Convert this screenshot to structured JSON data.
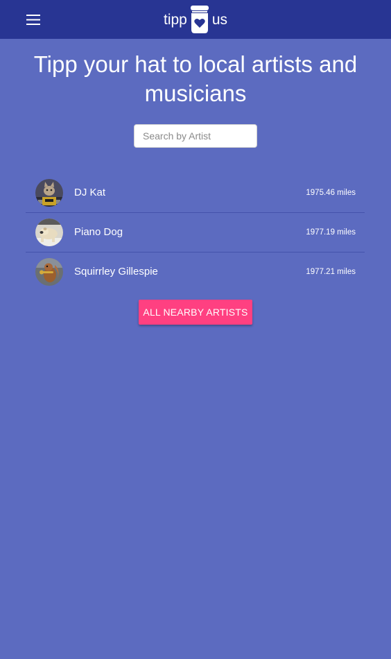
{
  "app": {
    "logo_left": "tipp",
    "logo_right": "us",
    "menu_icon": "hamburger-menu-icon"
  },
  "hero": {
    "headline": "Tipp your hat to local artists and musicians"
  },
  "search": {
    "placeholder": "Search by Artist",
    "value": ""
  },
  "artists": [
    {
      "name": "DJ Kat",
      "distance": "1975.46 miles",
      "avatar": "cat-dj-avatar"
    },
    {
      "name": "Piano Dog",
      "distance": "1977.19 miles",
      "avatar": "dog-piano-avatar"
    },
    {
      "name": "Squirrley Gillespie",
      "distance": "1977.21 miles",
      "avatar": "squirrel-trumpet-avatar"
    }
  ],
  "actions": {
    "all_nearby_label": "ALL NEARBY ARTISTS"
  },
  "colors": {
    "page_background": "#5c6bc0",
    "topbar": "#283593",
    "accent_button": "#ff4081",
    "text": "#ffffff"
  }
}
